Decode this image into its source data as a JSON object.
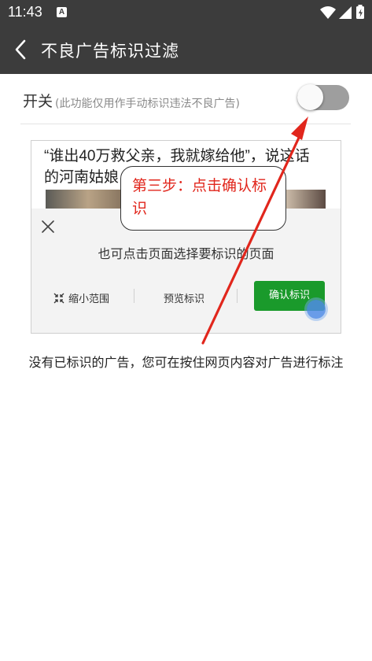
{
  "status_bar": {
    "time": "11:43",
    "notification_letter": "A",
    "icons": [
      "wifi-icon",
      "signal-icon",
      "battery-icon"
    ]
  },
  "app_bar": {
    "title": "不良广告标识过滤",
    "back_icon": "chevron-left-icon"
  },
  "switch_row": {
    "label": "开关",
    "hint": "(此功能仅用作手动标识违法不良广告)",
    "state": "off"
  },
  "demo": {
    "news_title_line1": "“谁出40万救父亲，我就嫁给他”，说这话",
    "news_title_line2": "的河南姑娘",
    "sheet_hint": "也可点击页面选择要标识的页面",
    "shrink_label": "缩小范围",
    "preview_label": "预览标识",
    "confirm_label": "确认标识",
    "close_icon": "close-icon",
    "shrink_icon": "shrink-icon"
  },
  "callout": {
    "text": "第三步：点击确认标识"
  },
  "empty_note": "没有已标识的广告，您可在按住网页内容对广告进行标注",
  "colors": {
    "header_bg": "#3c3c3c",
    "confirm_green": "#1a9a2b",
    "annotation_red": "#e1261c",
    "toggle_off": "#9e9e9e"
  }
}
